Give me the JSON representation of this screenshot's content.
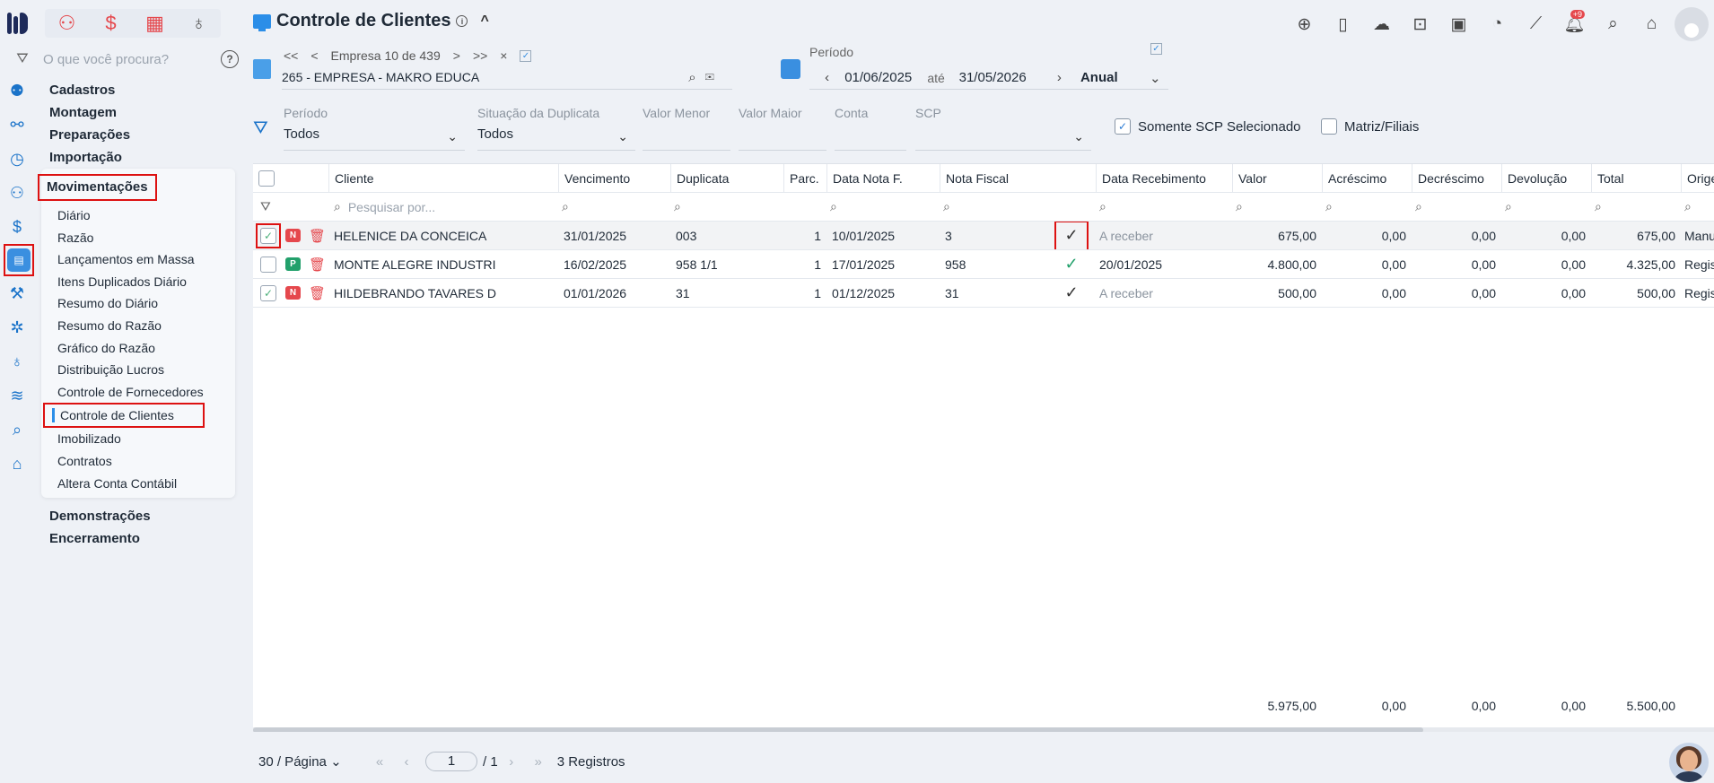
{
  "header": {
    "title": "Controle de Clientes",
    "caret": "^"
  },
  "nav_search": {
    "placeholder": "O que você procura?",
    "help": "?"
  },
  "nav": {
    "groups_top": [
      "Cadastros",
      "Montagem",
      "Preparações",
      "Importação"
    ],
    "active_group": "Movimentações",
    "items": [
      "Diário",
      "Razão",
      "Lançamentos em Massa",
      "Itens Duplicados Diário",
      "Resumo do Diário",
      "Resumo do Razão",
      "Gráfico do Razão",
      "Distribuição Lucros",
      "Controle de Fornecedores",
      "Controle de Clientes",
      "Imobilizado",
      "Contratos",
      "Altera Conta Contábil"
    ],
    "selected_item": "Controle de Clientes",
    "groups_bottom": [
      "Demonstrações",
      "Encerramento"
    ]
  },
  "empresa": {
    "counter": "Empresa 10 de 439",
    "name": "265 - EMPRESA - MAKRO EDUCA",
    "first": "<<",
    "prev": "<",
    "next": ">",
    "last": ">>",
    "close": "×"
  },
  "periodo": {
    "label": "Período",
    "start": "01/06/2025",
    "sep": "até",
    "end": "31/05/2026",
    "mode": "Anual"
  },
  "filters": {
    "periodo": {
      "label": "Período",
      "value": "Todos"
    },
    "situacao": {
      "label": "Situação da Duplicata",
      "value": "Todos"
    },
    "valor_menor": {
      "label": "Valor Menor",
      "value": ""
    },
    "valor_maior": {
      "label": "Valor Maior",
      "value": ""
    },
    "conta": {
      "label": "Conta",
      "value": ""
    },
    "scp": {
      "label": "SCP",
      "value": ""
    },
    "somente_scp": {
      "label": "Somente SCP Selecionado",
      "checked": true
    },
    "matriz": {
      "label": "Matriz/Filiais",
      "checked": false
    }
  },
  "table": {
    "columns": {
      "cliente": "Cliente",
      "vencimento": "Vencimento",
      "duplicata": "Duplicata",
      "parc": "Parc.",
      "data_nota": "Data Nota F.",
      "nota_fiscal": "Nota Fiscal",
      "data_receb": "Data Recebimento",
      "valor": "Valor",
      "acrescimo": "Acréscimo",
      "decrescimo": "Decréscimo",
      "devolucao": "Devolução",
      "total": "Total",
      "origem": "Origem"
    },
    "search_placeholder": "Pesquisar por...",
    "rows": [
      {
        "tag": "N",
        "cliente": "HELENICE DA CONCEICA",
        "vencimento": "31/01/2025",
        "duplicata": "003",
        "parc": "1",
        "data_nota": "10/01/2025",
        "nota_fiscal": "3",
        "tick": "✓",
        "data_receb": "A receber",
        "valor": "675,00",
        "acrescimo": "0,00",
        "decrescimo": "0,00",
        "devolucao": "0,00",
        "total": "675,00",
        "origem": "Manu"
      },
      {
        "tag": "P",
        "cliente": "MONTE ALEGRE INDUSTRI",
        "vencimento": "16/02/2025",
        "duplicata": "958 1/1",
        "parc": "1",
        "data_nota": "17/01/2025",
        "nota_fiscal": "958",
        "tick": "✓",
        "data_receb": "20/01/2025",
        "valor": "4.800,00",
        "acrescimo": "0,00",
        "decrescimo": "0,00",
        "devolucao": "0,00",
        "total": "4.325,00",
        "origem": "Regis"
      },
      {
        "tag": "N",
        "cliente": "HILDEBRANDO TAVARES D",
        "vencimento": "01/01/2026",
        "duplicata": "31",
        "parc": "1",
        "data_nota": "01/12/2025",
        "nota_fiscal": "31",
        "tick": "✓",
        "data_receb": "A receber",
        "valor": "500,00",
        "acrescimo": "0,00",
        "decrescimo": "0,00",
        "devolucao": "0,00",
        "total": "500,00",
        "origem": "Regis"
      }
    ],
    "totals": {
      "valor": "5.975,00",
      "acrescimo": "0,00",
      "decrescimo": "0,00",
      "devolucao": "0,00",
      "total": "5.500,00"
    }
  },
  "pager": {
    "per_page": "30 / Página",
    "page": "1",
    "of": "/ 1",
    "records": "3 Registros"
  },
  "notification_badge": "+9",
  "colors": {
    "accent": "#2b8ee8",
    "danger": "#e5484d",
    "success": "#22a06b",
    "highlight": "#dd1111"
  }
}
